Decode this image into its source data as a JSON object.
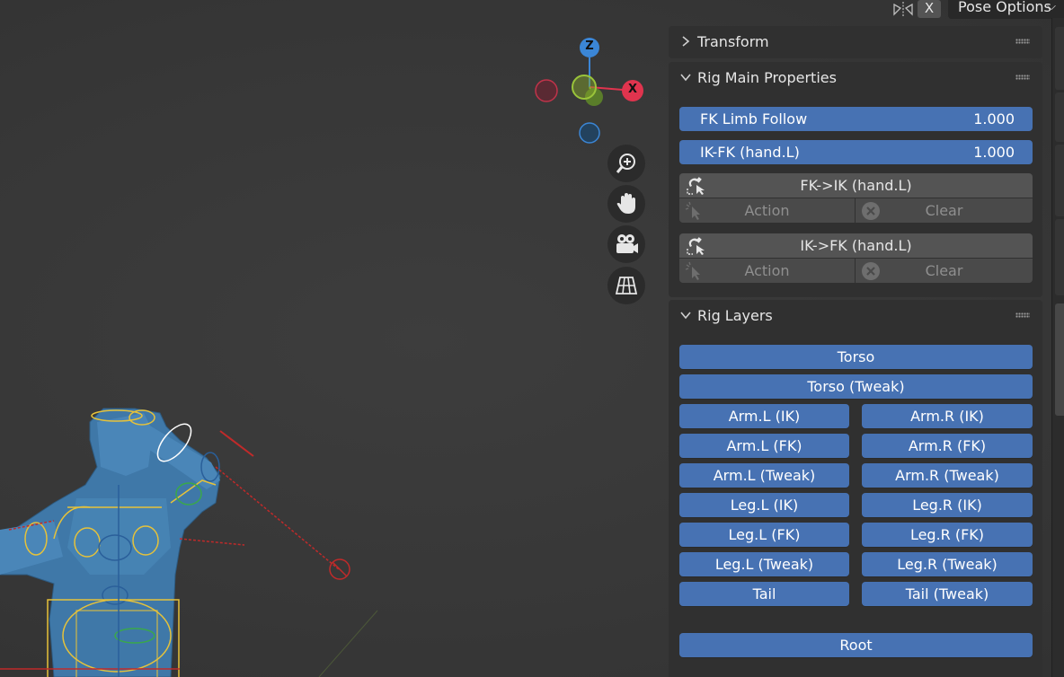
{
  "header": {
    "x_label": "X",
    "pose_options_label": "Pose Options",
    "icons": [
      "selection-mirror-icon",
      "chevron-down-icon"
    ]
  },
  "gizmo": {
    "z_label": "Z",
    "x_label": "X",
    "colors": {
      "x": "#e0344e",
      "y": "#87c236",
      "z": "#3b86d6"
    }
  },
  "nav_buttons": [
    "zoom-icon",
    "pan-hand-icon",
    "camera-icon",
    "grid-perspective-icon"
  ],
  "panels": {
    "transform": {
      "title": "Transform"
    },
    "rig_main": {
      "title": "Rig Main Properties",
      "fk_limb_follow": {
        "label": "FK Limb Follow",
        "value": "1.000"
      },
      "ik_fk": {
        "label": "IK-FK (hand.L)",
        "value": "1.000"
      },
      "fk_to_ik": {
        "label": "FK->IK (hand.L)",
        "action": "Action",
        "clear": "Clear"
      },
      "ik_to_fk": {
        "label": "IK->FK (hand.L)",
        "action": "Action",
        "clear": "Clear"
      }
    },
    "rig_layers": {
      "title": "Rig Layers",
      "torso": "Torso",
      "torso_tweak": "Torso (Tweak)",
      "pairs": [
        [
          "Arm.L (IK)",
          "Arm.R (IK)"
        ],
        [
          "Arm.L (FK)",
          "Arm.R (FK)"
        ],
        [
          "Arm.L (Tweak)",
          "Arm.R (Tweak)"
        ],
        [
          "Leg.L (IK)",
          "Leg.R (IK)"
        ],
        [
          "Leg.L (FK)",
          "Leg.R (FK)"
        ],
        [
          "Leg.L (Tweak)",
          "Leg.R (Tweak)"
        ],
        [
          "Tail",
          "Tail (Tweak)"
        ]
      ],
      "root": "Root"
    }
  },
  "colors": {
    "accent_blue": "#4772b3",
    "panel_bg": "#303030",
    "viewport_bg": "#393939"
  }
}
